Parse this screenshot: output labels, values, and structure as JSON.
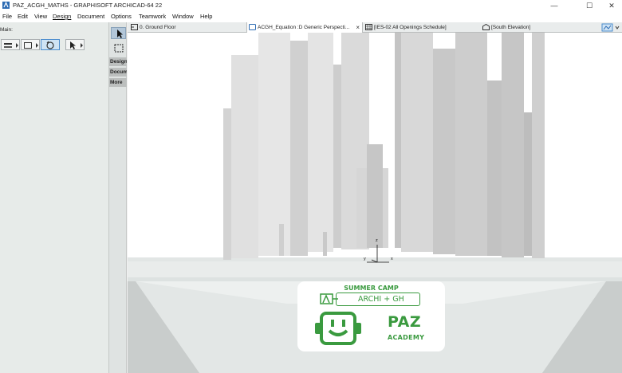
{
  "window": {
    "title": "PAZ_ACGH_MATHS - GRAPHISOFT ARCHICAD-64 22",
    "controls": [
      "minimize",
      "maximize",
      "close"
    ]
  },
  "menu": [
    "File",
    "Edit",
    "View",
    "Design",
    "Document",
    "Options",
    "Teamwork",
    "Window",
    "Help"
  ],
  "left_panel": {
    "label": "Main:"
  },
  "toolbox": {
    "groups": [
      "Design",
      "Docum",
      "More"
    ]
  },
  "tabs": [
    {
      "label": "0. Ground Floor",
      "icon": "floor-plan-icon",
      "active": false
    },
    {
      "label": "ACGH_Equation :D Generic Perspecti...",
      "icon": "3d-view-icon",
      "active": true
    },
    {
      "label": "[IES-02 All Openings Schedule]",
      "icon": "schedule-icon",
      "active": false
    },
    {
      "label": "[South Elevation]",
      "icon": "elevation-icon",
      "active": false
    }
  ],
  "viewport": {
    "axes": {
      "x": "x",
      "y": "y",
      "z": "z"
    },
    "logo": {
      "top_text": "SUMMER CAMP",
      "pill_text": "ARCHI + GH",
      "brand": "PAZ",
      "sub": "ACADEMY",
      "color": "#3a9a3f"
    }
  },
  "colors": {
    "accent": "#4b8ccd",
    "ground": "#e4e8e7",
    "tower_light": "#e8e8e8",
    "tower_dark": "#c2c2c2"
  }
}
